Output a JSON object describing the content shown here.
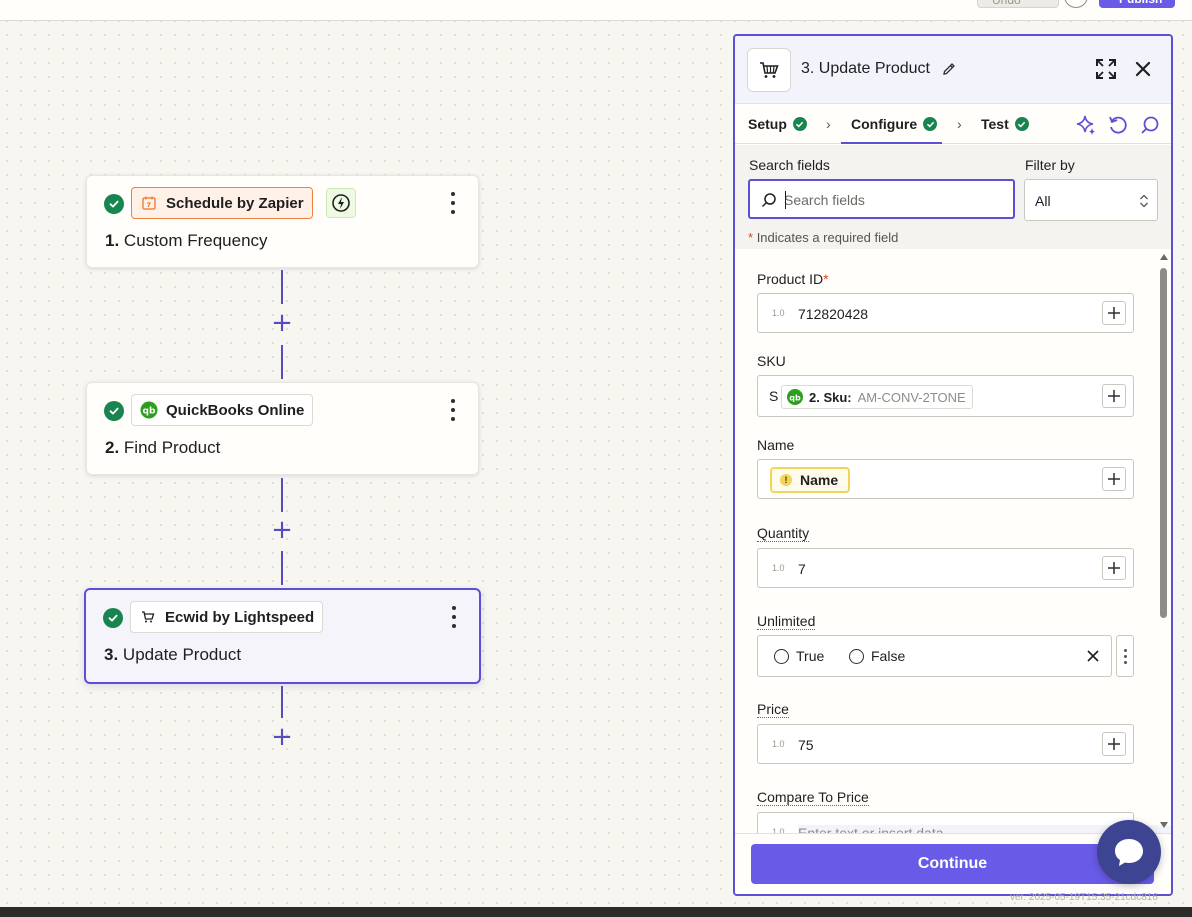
{
  "topbar": {
    "undo_label": "Undo",
    "publish_label": "Publish"
  },
  "steps": [
    {
      "app": "Schedule by Zapier",
      "number": "1.",
      "title": "Custom Frequency"
    },
    {
      "app": "QuickBooks Online",
      "number": "2.",
      "title": "Find Product"
    },
    {
      "app": "Ecwid by Lightspeed",
      "number": "3.",
      "title": "Update Product"
    }
  ],
  "panel": {
    "title": "3. Update Product",
    "tabs": [
      {
        "label": "Setup",
        "complete": true
      },
      {
        "label": "Configure",
        "complete": true,
        "active": true
      },
      {
        "label": "Test",
        "complete": true
      }
    ],
    "search": {
      "label": "Search fields",
      "placeholder": "Search fields"
    },
    "filter": {
      "label": "Filter by",
      "value": "All"
    },
    "required_note": "Indicates a required field",
    "fields": {
      "product_id": {
        "label": "Product ID",
        "required": "*",
        "value": "712820428",
        "type_icon": "1.0"
      },
      "sku": {
        "label": "SKU",
        "prefix": "S",
        "chip_label": "2. Sku:",
        "chip_value": "AM-CONV-2TONE"
      },
      "name": {
        "label": "Name",
        "chip_label": "Name"
      },
      "quantity": {
        "label": "Quantity",
        "value": "7",
        "type_icon": "1.0"
      },
      "unlimited": {
        "label": "Unlimited",
        "option_true": "True",
        "option_false": "False"
      },
      "price": {
        "label": "Price",
        "value": "75",
        "type_icon": "1.0"
      },
      "compare_to_price": {
        "label": "Compare To Price",
        "placeholder": "Enter text or insert data",
        "type_icon": "1.0"
      }
    },
    "continue_label": "Continue"
  },
  "version": "ver. 2025-05-19T15:35-21cdc816",
  "colors": {
    "accent": "#5c4fd6",
    "button": "#695be8",
    "success": "#188550",
    "warning": "#f2d45a",
    "schedule_orange": "#f0823f",
    "quickbooks_green": "#2ca01c"
  }
}
